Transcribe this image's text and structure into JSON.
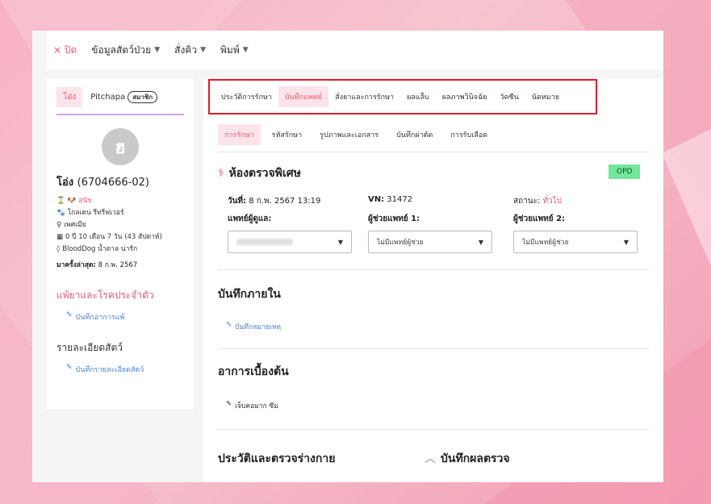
{
  "topbar": {
    "close": "× ปิด",
    "menu": [
      {
        "label": "ข้อมูลสัตว์ป่วย"
      },
      {
        "label": "สั่งคิว"
      },
      {
        "label": "พิมพ์"
      }
    ]
  },
  "left": {
    "tabs": {
      "active": "โอ่ง",
      "owner": "Pitchapa",
      "badge": "สมาชิก"
    },
    "avatar_initial": "ฮ",
    "pet_name": "โอ่ง",
    "pet_id": "(6704666-02)",
    "lines": [
      {
        "text": "สุนัข"
      },
      {
        "text": "โกลเดน รีทรีฟเวอร์"
      },
      {
        "text": "เพศเมีย"
      },
      {
        "text": "0 ปี 10 เดือน 7 วัน (43 สัปดาห์)"
      },
      {
        "text": "BloodDog  น้ำตาล  น่ารัก"
      }
    ],
    "last_visit_label": "มาครั้งล่าสุด:",
    "last_visit_value": "8 ก.พ. 2567",
    "allergy_title": "แพ้ยาและโรคประจำตัว",
    "allergy_link": "บันทึกอาการแพ้",
    "detail_title": "รายละเอียดสัตว์",
    "detail_link": "บันทึกรายละเอียดสัตว์"
  },
  "main": {
    "tabs": [
      "ประวัติการรักษา",
      "บันทึกแพทย์",
      "สั่งยาและการรักษา",
      "ผลแล็บ",
      "ผลภาพวินิจฉัย",
      "วัคซีน",
      "นัดหมาย"
    ],
    "active_tab": "บันทึกแพทย์",
    "subtabs": [
      "การรักษา",
      "รหัสรักษา",
      "รูปภาพและเอกสาร",
      "บันทึกผ่าตัด",
      "การรับเลือด"
    ],
    "active_subtab": "การรักษา",
    "room": "ห้องตรวจพิเศษ",
    "badge": "OPD",
    "date_label": "วันที่:",
    "date_value": "8 ก.พ. 2567 13:19",
    "vn_label": "VN:",
    "vn_value": "31472",
    "status_label": "สถานะ:",
    "status_value": "ทั่วไป",
    "doctor_label": "แพทย์ผู้ดูแล:",
    "assist1_label": "ผู้ช่วยแพทย์ 1:",
    "assist2_label": "ผู้ช่วยแพทย์ 2:",
    "doctor_value": "",
    "assist_placeholder": "ไม่มีแพทย์ผู้ช่วย",
    "internal_title": "บันทึกภายใน",
    "internal_link": "บันทึกหมายเหตุ",
    "symptom_title": "อาการเบื้องต้น",
    "symptom_note": "เจ็บคอมาก ซึม",
    "history_title": "ประวัติและตรวจร่างกาย",
    "result_title": "บันทึกผลตรวจ"
  }
}
